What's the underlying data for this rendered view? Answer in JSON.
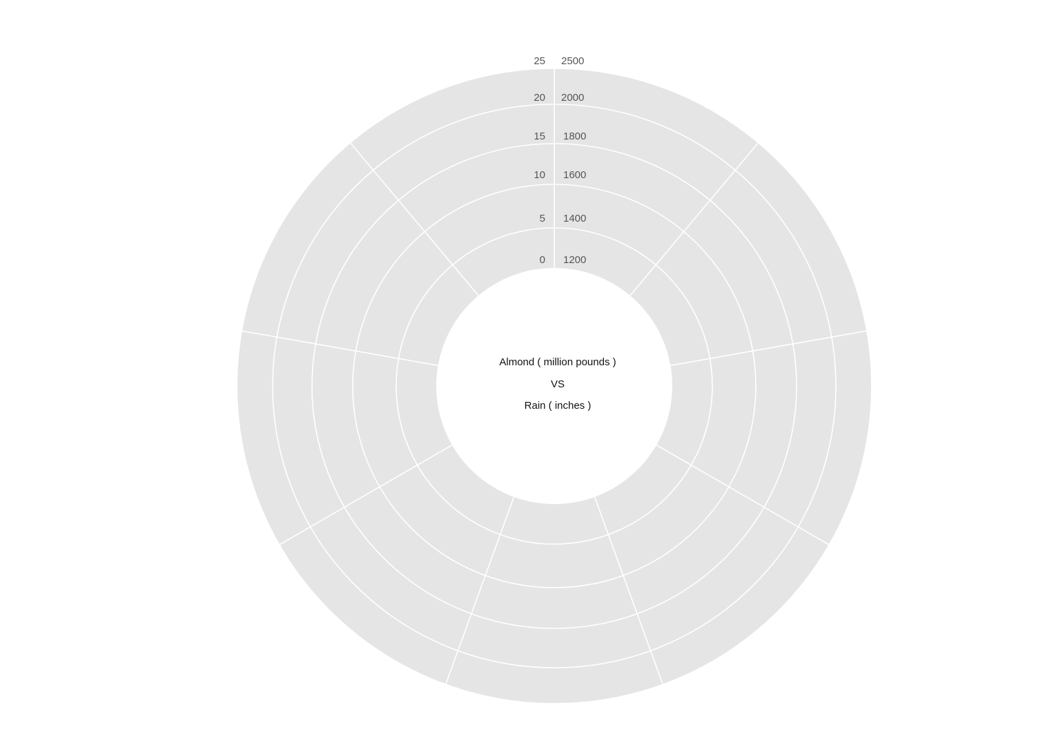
{
  "chart_data": {
    "type": "radial-bar",
    "center_lines": [
      "Almond ( million pounds )",
      "VS",
      "Rain ( inches )"
    ],
    "rain_axis": {
      "label": "Rain ( inches )",
      "ticks": [
        "0",
        "5",
        "10",
        "15",
        "20",
        "25"
      ],
      "range": [
        0,
        25
      ]
    },
    "almond_axis": {
      "label": "Almond ( million pounds )",
      "ticks": [
        "1200",
        "1400",
        "1600",
        "1800",
        "2000",
        "2500"
      ],
      "range": [
        1200,
        2500
      ]
    },
    "sector_count": 9,
    "series": [],
    "grid": true,
    "colors": {
      "background": "#ffffff",
      "ring_fill": "#e5e5e6",
      "grid_line": "#ffffff",
      "tick_text": "#555555",
      "center_text": "#111111"
    }
  }
}
